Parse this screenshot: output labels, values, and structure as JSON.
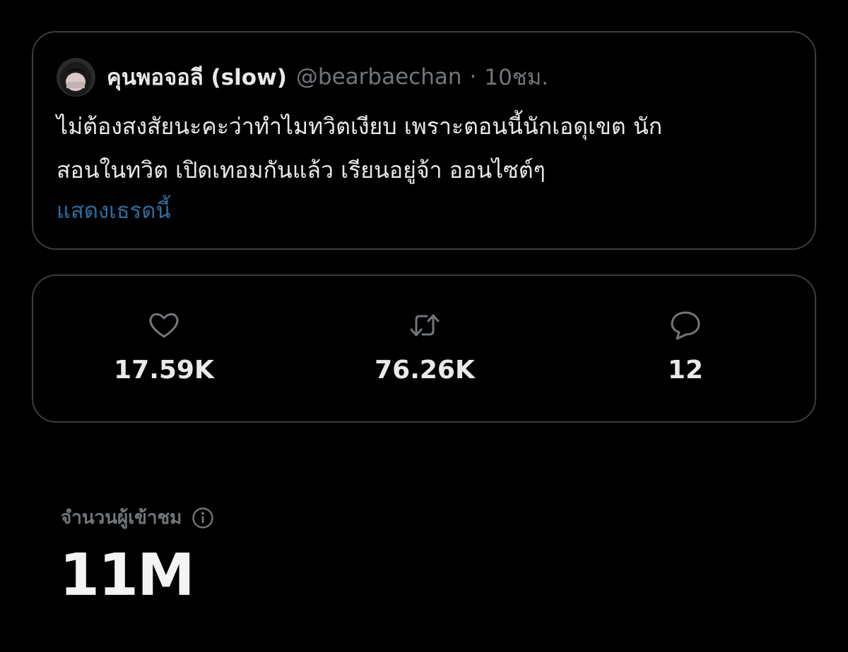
{
  "quoted_tweet": {
    "display_name": "คุนพอจอลี (slow)",
    "handle": "@bearbaechan",
    "separator": "·",
    "time": "10ชม.",
    "text_line_1": "ไม่ต้องสงสัยนะคะว่าทำไมทวิตเงียบ เพราะตอนนี้นักเอดุเขต นัก",
    "text_line_2": "สอนในทวิต เปิดเทอมกันแล้ว เรียนอยู่จ้า ออนไซต์ๆ",
    "show_thread_label": "แสดงเธรดนี้"
  },
  "stats": {
    "likes": "17.59K",
    "retweets": "76.26K",
    "replies": "12"
  },
  "views": {
    "label": "จำนวนผู้เข้าชม",
    "count": "11M"
  },
  "colors": {
    "background": "#000000",
    "border": "#3a3d41",
    "text_primary": "#e7e9ea",
    "text_secondary": "#71767b",
    "link": "#2f6ca0"
  },
  "icons": {
    "like": "heart-icon",
    "retweet": "retweet-icon",
    "reply": "reply-icon",
    "info": "info-icon"
  }
}
